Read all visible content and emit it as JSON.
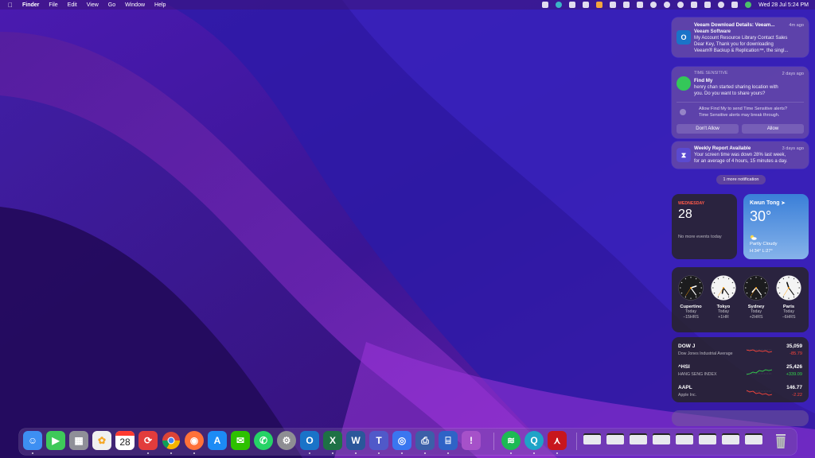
{
  "menubar": {
    "app_name": "Finder",
    "menus": [
      "File",
      "Edit",
      "View",
      "Go",
      "Window",
      "Help"
    ],
    "datetime": "Wed 28 Jul  5:24 PM",
    "status_icons": [
      "screen-icon",
      "teal-app-icon",
      "app-icon",
      "text-a-icon",
      "grid-icon",
      "display-icon",
      "chat-icon",
      "m-icon",
      "bluetooth-icon",
      "wifi-icon",
      "clock-icon",
      "battery-icon",
      "lock-icon",
      "search-icon",
      "control-center-icon",
      "siri-icon"
    ]
  },
  "notifications": [
    {
      "app": "outlook",
      "title": "Veeam Download Details: Veeam...",
      "time": "4m ago",
      "body": [
        "Veeam Software",
        "My Account Resource Library Contact Sales",
        "Dear Key, Thank you for downloading",
        "Veeam® Backup & Replication™, the singl..."
      ]
    },
    {
      "app": "findmy",
      "label": "TIME SENSITIVE",
      "title": "Find My",
      "time": "2 days ago",
      "body": [
        "henry chan started sharing location with",
        "you. Do you want to share yours?"
      ],
      "prompt": [
        "Allow Find My to send Time Sensitive alerts?",
        "Time Sensitive alerts may break through."
      ],
      "buttons": [
        "Don't Allow",
        "Allow"
      ]
    },
    {
      "app": "screen-time",
      "title": "Weekly Report Available",
      "time": "3 days ago",
      "body": [
        "Your screen time was down 28% last week,",
        "for an average of 4 hours, 15 minutes a day."
      ]
    }
  ],
  "more_notifications": "1 more notification",
  "calendar": {
    "weekday": "WEDNESDAY",
    "day": "28",
    "events": "No more events today"
  },
  "weather": {
    "city": "Kwun Tong",
    "temp": "30°",
    "condition": "Partly Cloudy",
    "hilo": "H:34° L:27°"
  },
  "world_clock": [
    {
      "city": "Cupertino",
      "day": "Today",
      "offset": "−15HRS",
      "hour": 2,
      "minute": 24,
      "dark": true
    },
    {
      "city": "Tokyo",
      "day": "Today",
      "offset": "+1HR",
      "hour": 6,
      "minute": 24,
      "dark": false
    },
    {
      "city": "Sydney",
      "day": "Today",
      "offset": "+2HRS",
      "hour": 7,
      "minute": 24,
      "dark": true
    },
    {
      "city": "Paris",
      "day": "Today",
      "offset": "−6HRS",
      "hour": 11,
      "minute": 24,
      "dark": false
    }
  ],
  "stocks": [
    {
      "symbol": "DOW J",
      "name": "Dow Jones Industrial Average",
      "price": "35,059",
      "change": "-85.79",
      "dir": "neg"
    },
    {
      "symbol": "^HSI",
      "name": "HANG SENG INDEX",
      "price": "25,426",
      "change": "+339.09",
      "dir": "pos"
    },
    {
      "symbol": "AAPL",
      "name": "Apple Inc.",
      "price": "146.77",
      "change": "-2.22",
      "dir": "neg"
    }
  ],
  "calendar_dock_date": "28",
  "dock": {
    "apps": [
      "finder",
      "facetime",
      "launchpad",
      "photos",
      "calendar",
      "sync-app",
      "chrome",
      "firefox",
      "app-store",
      "wechat",
      "whatsapp",
      "system-preferences",
      "outlook",
      "excel",
      "word",
      "teams",
      "signal",
      "printer",
      "scanner",
      "feedback"
    ],
    "apps2": [
      "spotify",
      "quicktime-search",
      "acrobat"
    ],
    "colors": {
      "finder": "#3d8ff2",
      "facetime": "#3ec95a",
      "launchpad": "#8f8f98",
      "photos": "#f0f0f0",
      "calendar": "#ffffff",
      "sync-app": "#e23c3c",
      "chrome": "#f4f4f4",
      "firefox": "#ff7139",
      "app-store": "#1c8bf5",
      "wechat": "#2dc100",
      "whatsapp": "#25d366",
      "system-preferences": "#8e8e93",
      "outlook": "#1a73c8",
      "excel": "#1e7145",
      "word": "#2b579a",
      "teams": "#5059c9",
      "signal": "#3a76f0",
      "printer": "#3c5fa8",
      "scanner": "#2f63c6",
      "feedback": "#a651c9",
      "spotify": "#1db954",
      "quicktime-search": "#1fa3c7",
      "acrobat": "#c8161d",
      "trash": "#b8b8c0"
    }
  }
}
